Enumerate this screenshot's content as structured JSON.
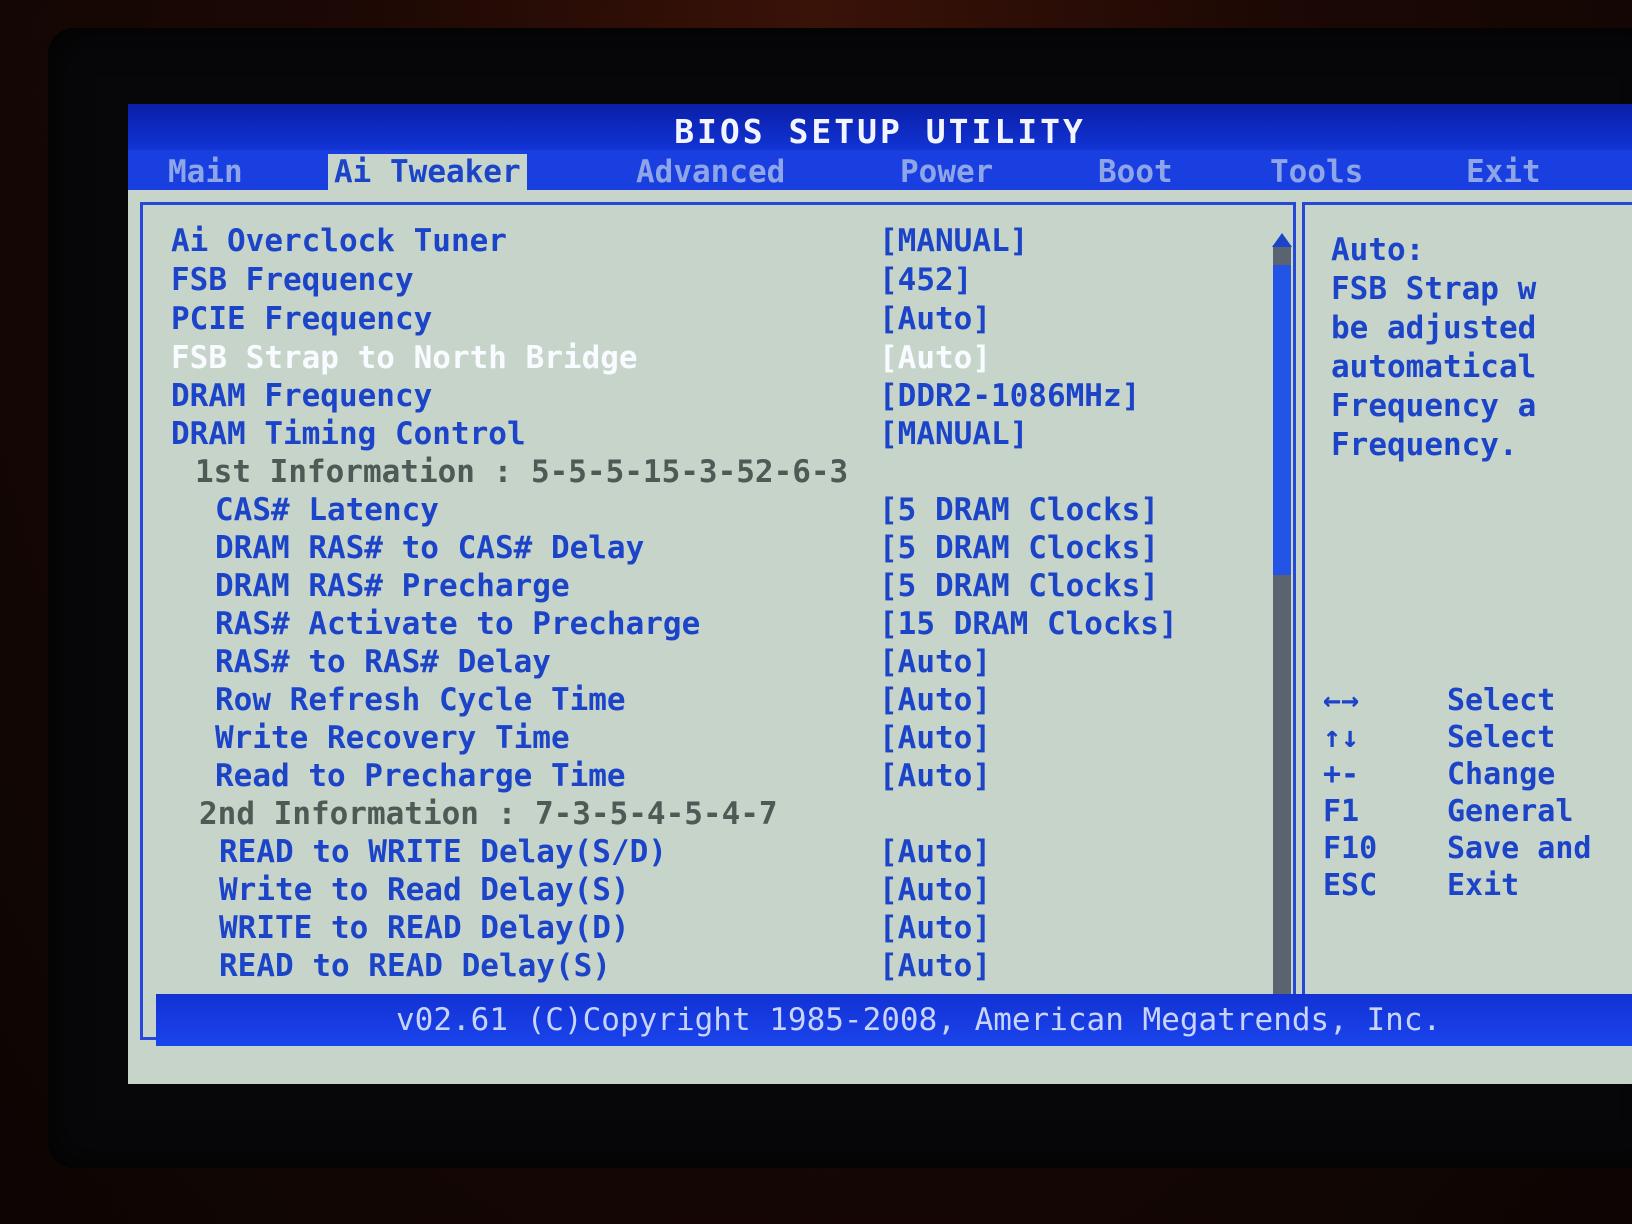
{
  "title": "BIOS SETUP UTILITY",
  "tabs": [
    {
      "label": "Main"
    },
    {
      "label": "Ai Tweaker"
    },
    {
      "label": "Advanced"
    },
    {
      "label": "Power"
    },
    {
      "label": "Boot"
    },
    {
      "label": "Tools"
    },
    {
      "label": "Exit"
    }
  ],
  "active_tab": "Ai Tweaker",
  "settings": [
    {
      "label": "Ai Overclock Tuner",
      "value": "[MANUAL]"
    },
    {
      "label": "FSB Frequency",
      "value": "[452]"
    },
    {
      "label": "PCIE Frequency",
      "value": "[Auto]"
    },
    {
      "label": "FSB Strap to North Bridge",
      "value": "[Auto]"
    },
    {
      "label": "DRAM Frequency",
      "value": "[DDR2-1086MHz]"
    },
    {
      "label": "DRAM Timing Control",
      "value": "[MANUAL]"
    },
    {
      "label": "1st Information : 5-5-5-15-3-52-6-3",
      "value": ""
    },
    {
      "label": "CAS# Latency",
      "value": "[5 DRAM Clocks]"
    },
    {
      "label": "DRAM RAS# to CAS# Delay",
      "value": "[5 DRAM Clocks]"
    },
    {
      "label": "DRAM RAS# Precharge",
      "value": "[5 DRAM Clocks]"
    },
    {
      "label": "RAS# Activate to Precharge",
      "value": "[15 DRAM Clocks]"
    },
    {
      "label": "RAS# to RAS# Delay",
      "value": "[Auto]"
    },
    {
      "label": "Row Refresh Cycle Time",
      "value": "[Auto]"
    },
    {
      "label": "Write Recovery Time",
      "value": "[Auto]"
    },
    {
      "label": "Read to Precharge Time",
      "value": "[Auto]"
    },
    {
      "label": "2nd Information : 7-3-5-4-5-4-7",
      "value": ""
    },
    {
      "label": "READ to WRITE Delay(S/D)",
      "value": "[Auto]"
    },
    {
      "label": "Write to Read Delay(S)",
      "value": "[Auto]"
    },
    {
      "label": "WRITE to READ Delay(D)",
      "value": "[Auto]"
    },
    {
      "label": "READ to READ Delay(S)",
      "value": "[Auto]"
    }
  ],
  "help": {
    "lines": [
      "Auto:",
      "FSB Strap w",
      "be adjusted",
      "automatical",
      "Frequency a",
      "Frequency."
    ]
  },
  "keys": [
    {
      "key": "←→",
      "desc": "Select"
    },
    {
      "key": "↑↓",
      "desc": "Select"
    },
    {
      "key": "+-",
      "desc": "Change"
    },
    {
      "key": "F1",
      "desc": "General"
    },
    {
      "key": "F10",
      "desc": "Save and"
    },
    {
      "key": "ESC",
      "desc": "Exit"
    }
  ],
  "footer": "v02.61 (C)Copyright 1985-2008, American Megatrends, Inc."
}
